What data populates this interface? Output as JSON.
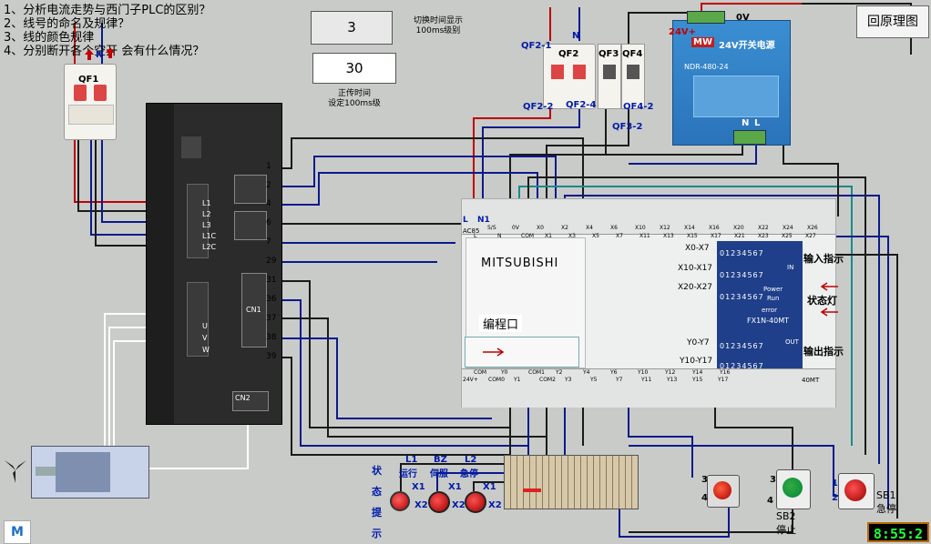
{
  "questions": [
    "1、分析电流走势与西门子PLC的区别？",
    "2、线号的命名及规律？",
    "3、线的颜色规律",
    "4、分别断开各个空开 会有什么情况？"
  ],
  "timer_inputs": {
    "switch_value": "3",
    "switch_caption": "切换时间显示\n100ms级别",
    "rotate_value": "30",
    "rotate_caption": "正传时间\n设定100ms级"
  },
  "back_button": "回原理图",
  "clock": "8:55:2",
  "breakers": {
    "qf1": "QF1",
    "qf1_n": "N",
    "qf2": "QF2",
    "qf2_n": "N",
    "qf3": "QF3",
    "qf4": "QF4",
    "qf2_1": "QF2-1",
    "qf2_2": "QF2-2",
    "qf2_4": "QF2-4",
    "qf3_2": "QF3-2",
    "qf4_2": "QF4-2"
  },
  "power_supply": {
    "title": "24V开关电源",
    "model": "NDR-480-24",
    "plus": "24V+",
    "zero": "0V",
    "brand": "MW",
    "n": "N",
    "l": "L"
  },
  "servo": {
    "l1": "L1",
    "l2": "L2",
    "l3": "L3",
    "l1c": "L1C",
    "l2c": "L2C",
    "u": "U",
    "v": "V",
    "w": "W",
    "cn1": "CN1",
    "cn2": "CN2",
    "pins": [
      "1",
      "2",
      "4",
      "6",
      "7",
      "29",
      "31",
      "36",
      "37",
      "38",
      "39"
    ]
  },
  "plc": {
    "brand": "MITSUBISHI",
    "model": "FX1N-40MT",
    "prog_port": "编程口",
    "input_indicator": "输入指示",
    "status_light": "状态灯",
    "output_indicator": "输出指示",
    "in": "IN",
    "out": "OUT",
    "power": "Power",
    "run": "Run",
    "error": "error",
    "x_rows": [
      "X0-X7",
      "X10-X17",
      "X20-X27"
    ],
    "y_rows": [
      "Y0-Y7",
      "Y10-Y17"
    ],
    "digits": "01234567",
    "top_terminals": [
      "S/S",
      "0V",
      "X0",
      "X2",
      "X4",
      "X6",
      "X10",
      "X12",
      "X14",
      "X16",
      "X20",
      "X22",
      "X24",
      "X26"
    ],
    "top_terminals2": [
      "L",
      "N",
      "COM",
      "X1",
      "X3",
      "X5",
      "X7",
      "X11",
      "X13",
      "X15",
      "X17",
      "X21",
      "X23",
      "X25",
      "X27"
    ],
    "l_label": "L",
    "n_label": "N1",
    "ac_label": "AC85",
    "bottom_terminals": [
      "COM",
      "Y0",
      "COM1",
      "Y2",
      "Y4",
      "Y6",
      "Y10",
      "Y12",
      "Y14",
      "Y16"
    ],
    "bottom_terminals2": [
      "24V+",
      "COM0",
      "Y1",
      "COM2",
      "Y3",
      "Y5",
      "Y7",
      "Y11",
      "Y13",
      "Y15",
      "Y17"
    ],
    "fourmt": "40MT"
  },
  "status_panel": {
    "vertical_title": [
      "状",
      "态",
      "提",
      "示"
    ],
    "l1": "L1",
    "l1_name": "运行",
    "bz": "BZ",
    "bz_name": "伺服",
    "l2": "L2",
    "l2_name": "急停",
    "x1": "X1",
    "x2": "X2"
  },
  "buttons": {
    "sb2": "SB2",
    "sb2_name": "停止",
    "sb1": "SB1",
    "sb1_name": "急停",
    "t3": "3",
    "t4": "4",
    "t1": "1",
    "t2": "2"
  },
  "logo": "M"
}
